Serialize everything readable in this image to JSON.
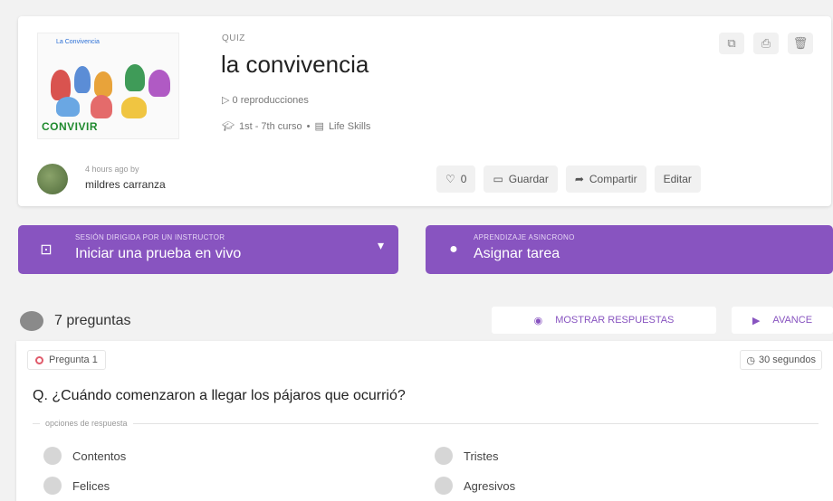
{
  "quiz": {
    "type_label": "QUIZ",
    "title": "la convivencia",
    "plays": "0 reproducciones",
    "grade": "1st - 7th curso",
    "separator": "•",
    "subject": "Life Skills",
    "thumbnail_title": "La Convivencia",
    "thumbnail_word": "CONVIVIR",
    "icons": [
      "copy-icon",
      "print-icon",
      "trash-icon"
    ]
  },
  "author": {
    "time": "4 hours ago by",
    "name": "mildres carranza"
  },
  "actions": {
    "like_count": "0",
    "save": "Guardar",
    "share": "Compartir",
    "edit": "Editar"
  },
  "live": {
    "caption": "SESIÓN DIRIGIDA POR UN INSTRUCTOR",
    "label": "Iniciar una prueba en vivo"
  },
  "homework": {
    "caption": "APRENDIZAJE ASINCRONO",
    "label": "Asignar tarea"
  },
  "questions": {
    "count_label": "7 preguntas",
    "show_answers": "MOSTRAR RESPUESTAS",
    "preview": "AVANCE"
  },
  "question1": {
    "number": "Pregunta 1",
    "time": "30 segundos",
    "text": "Q. ¿Cuándo comenzaron a llegar los pájaros que ocurrió?",
    "options_label": "opciones de respuesta",
    "options": [
      "Contentos",
      "Tristes",
      "Felices",
      "Agresivos"
    ]
  },
  "colors": {
    "accent": "#8854c0",
    "background": "#f2f2f2"
  }
}
